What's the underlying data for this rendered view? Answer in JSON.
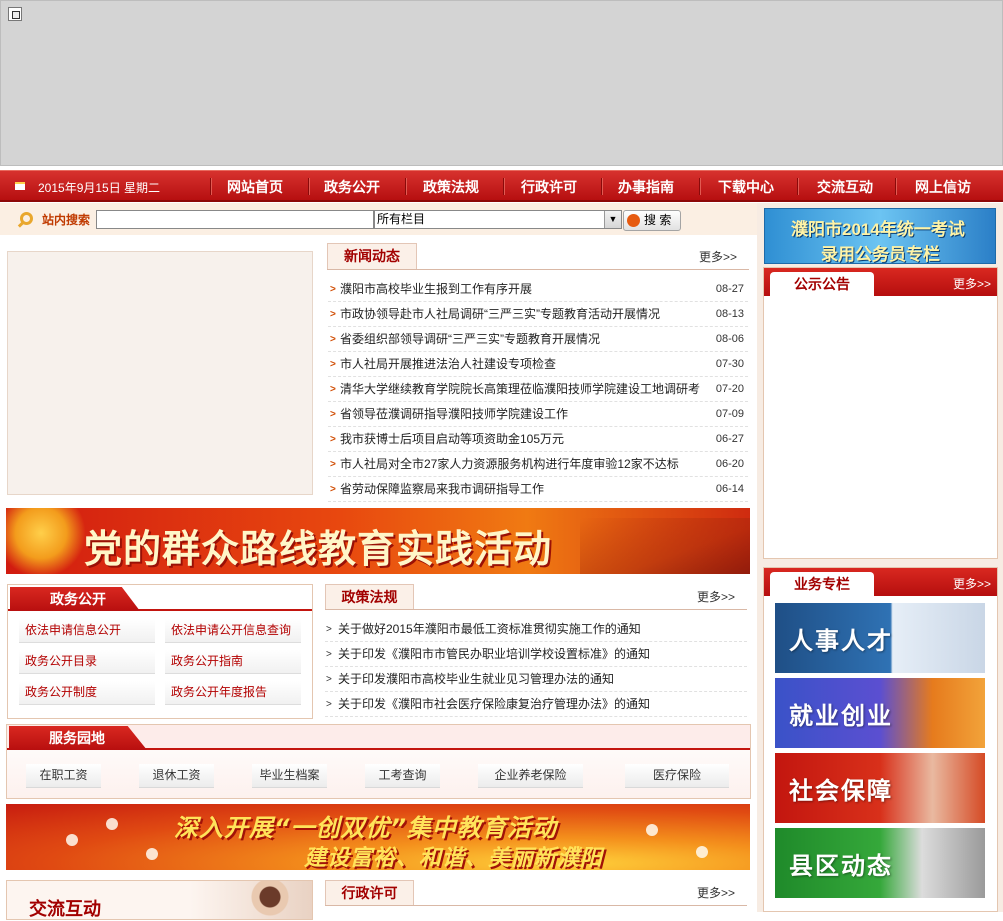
{
  "nav": {
    "date": "2015年9月15日 星期二",
    "items": [
      "网站首页",
      "政务公开",
      "政策法规",
      "行政许可",
      "办事指南",
      "下载中心",
      "交流互动",
      "网上信访"
    ]
  },
  "search": {
    "label": "站内搜索",
    "input_value": "",
    "select_value": "所有栏目",
    "button_label": "搜 索"
  },
  "news": {
    "title": "新闻动态",
    "more": "更多>>",
    "items": [
      {
        "text": "濮阳市高校毕业生报到工作有序开展",
        "date": "08-27"
      },
      {
        "text": "市政协领导赴市人社局调研“三严三实”专题教育活动开展情况",
        "date": "08-13"
      },
      {
        "text": "省委组织部领导调研“三严三实”专题教育开展情况",
        "date": "08-06"
      },
      {
        "text": "市人社局开展推进法治人社建设专项检查",
        "date": "07-30"
      },
      {
        "text": "清华大学继续教育学院院长高策理莅临濮阳技师学院建设工地调研考",
        "date": "07-20"
      },
      {
        "text": "省领导莅濮调研指导濮阳技师学院建设工作",
        "date": "07-09"
      },
      {
        "text": "我市获博士后项目启动等项资助金105万元",
        "date": "06-27"
      },
      {
        "text": "市人社局对全市27家人力资源服务机构进行年度审验12家不达标",
        "date": "06-20"
      },
      {
        "text": "省劳动保障监察局来我市调研指导工作",
        "date": "06-14"
      }
    ]
  },
  "banner1": {
    "text": "党的群众路线教育实践活动"
  },
  "zwgk": {
    "title": "政务公开",
    "links": [
      "依法申请信息公开",
      "依法申请公开信息查询",
      "政务公开目录",
      "政务公开指南",
      "政务公开制度",
      "政务公开年度报告"
    ]
  },
  "zcfg": {
    "title": "政策法规",
    "more": "更多>>",
    "items": [
      "关于做好2015年濮阳市最低工资标准贯彻实施工作的通知",
      "关于印发《濮阳市市管民办职业培训学校设置标准》的通知",
      "关于印发濮阳市高校毕业生就业见习管理办法的通知",
      "关于印发《濮阳市社会医疗保险康复治疗管理办法》的通知"
    ]
  },
  "fwyd": {
    "title": "服务园地",
    "buttons": [
      "在职工资",
      "退休工资",
      "毕业生档案",
      "工考查询",
      "企业养老保险",
      "医疗保险"
    ]
  },
  "banner2": {
    "line1": "深入开展“一创双优”集中教育活动",
    "line2": "建设富裕、和谐、美丽新濮阳"
  },
  "jlhd": {
    "title": "交流互动"
  },
  "xzxk": {
    "title": "行政许可",
    "more": "更多>>"
  },
  "exam": {
    "line1": "濮阳市2014年统一考试",
    "line2": "录用公务员专栏"
  },
  "gsgg": {
    "title": "公示公告",
    "more": "更多>>"
  },
  "ywzl": {
    "title": "业务专栏",
    "more": "更多>>",
    "items": [
      "人事人才",
      "就业创业",
      "社会保障",
      "县区动态"
    ]
  },
  "colors": {
    "primary_red": "#c3150f",
    "accent_orange": "#e65a10",
    "panel_bg": "#f7ece3"
  }
}
